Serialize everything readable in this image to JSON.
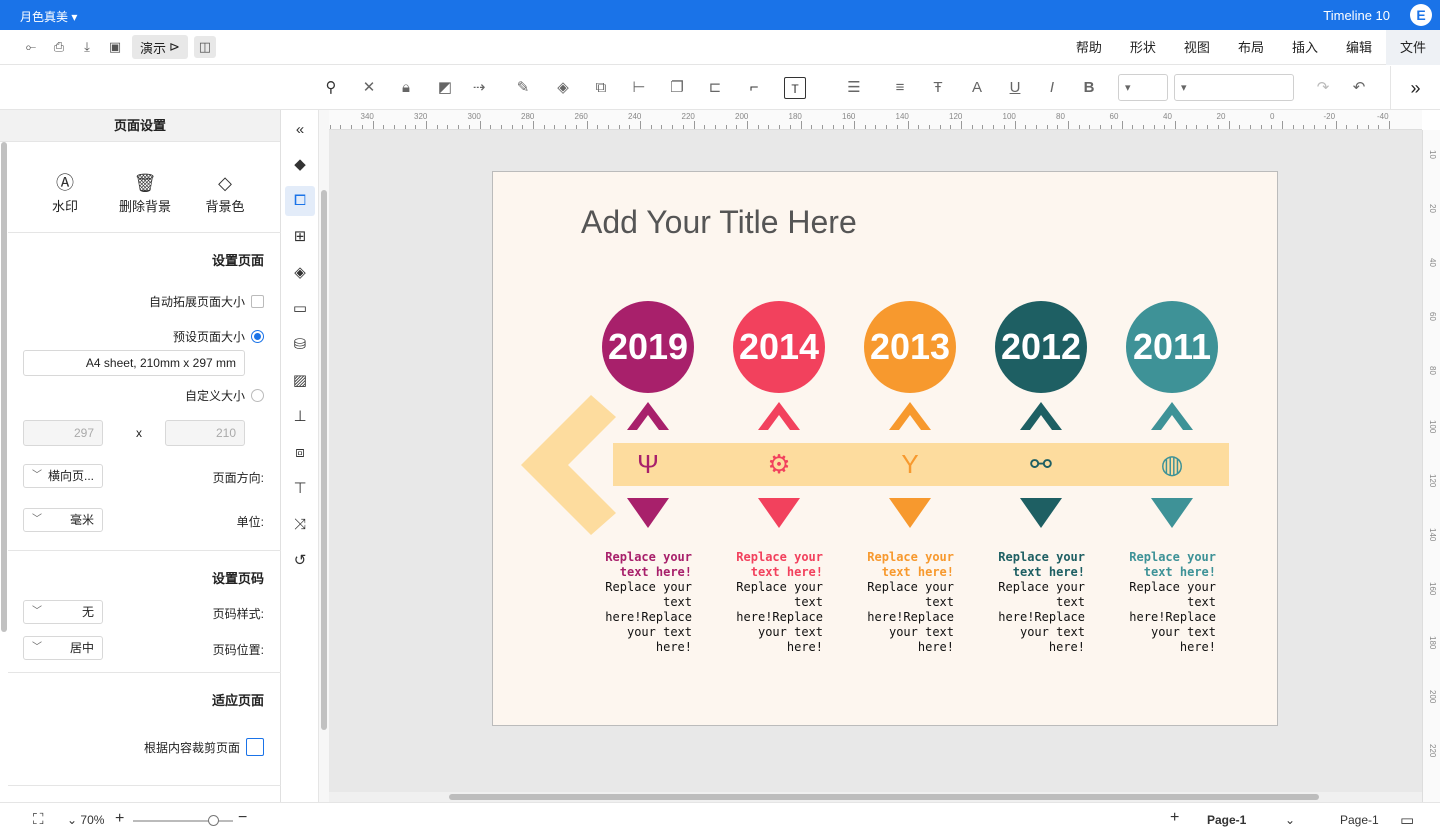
{
  "titlebar": {
    "doc_title": "Timeline 10",
    "theme_label": "月色真美",
    "logo": "E"
  },
  "menu": [
    "文件",
    "编辑",
    "插入",
    "布局",
    "视图",
    "形状",
    "帮助"
  ],
  "quick_access": {
    "present_label": "演示"
  },
  "toolbar": {
    "font_family_value": "",
    "font_size_value": ""
  },
  "left_panel": {
    "header": "页面设置",
    "bg_actions": [
      {
        "label": "背景色",
        "icon": "paint-bucket-icon"
      },
      {
        "label": "删除背景",
        "icon": "trash-icon"
      },
      {
        "label": "水印",
        "icon": "watermark-icon"
      }
    ],
    "page_setup": {
      "title": "设置页面",
      "auto_extend": "自动拓展页面大小",
      "preset_size": "预设页面大小",
      "preset_value": "A4 sheet, 210mm x 297 mm",
      "custom_size": "自定义大小",
      "width_value": "210",
      "height_value": "297",
      "x_sep": "x",
      "orientation_label": "页面方向:",
      "orientation_value": "横向页...",
      "unit_label": "单位:",
      "unit_value": "毫米"
    },
    "page_number": {
      "title": "设置页码",
      "style_label": "页码样式:",
      "style_value": "无",
      "position_label": "页码位置:",
      "position_value": "居中"
    },
    "fit_page": {
      "title": "适应页面",
      "crop_label": "根据内容裁剪页面"
    }
  },
  "ruler_labels": [
    "-40",
    "-20",
    "0",
    "20",
    "40",
    "60",
    "80",
    "100",
    "120",
    "140",
    "160",
    "180",
    "200",
    "220",
    "240",
    "260",
    "280",
    "300",
    "320",
    "340"
  ],
  "ruler_right_labels": [
    "10",
    "20",
    "40",
    "60",
    "80",
    "100",
    "120",
    "140",
    "160",
    "180",
    "200",
    "220"
  ],
  "canvas": {
    "title": "Add Your Title Here",
    "milestones": [
      {
        "year": "2011",
        "color": "#3e9297",
        "icon": "basketball-icon",
        "heading": "Replace your text here!",
        "body": "Replace your text here!Replace your text here!"
      },
      {
        "year": "2012",
        "color": "#1e5f63",
        "icon": "cyclist-icon",
        "heading": "Replace your text here!",
        "body": "Replace your text here!Replace your text here!"
      },
      {
        "year": "2013",
        "color": "#f7992e",
        "icon": "trophy-icon",
        "heading": "Replace your text here!",
        "body": "Replace your text here!Replace your text here!"
      },
      {
        "year": "2014",
        "color": "#f2415d",
        "icon": "gear-icon",
        "heading": "Replace your text here!",
        "body": "Replace your text here!Replace your text here!"
      },
      {
        "year": "2019",
        "color": "#a8206b",
        "icon": "usb-icon",
        "heading": "Replace your text here!",
        "body": "Replace your text here!Replace your text here!"
      }
    ],
    "band_color": "#fddc9e"
  },
  "statusbar": {
    "page_selector": "Page-1",
    "page_tab": "Page-1",
    "zoom": "70%"
  }
}
